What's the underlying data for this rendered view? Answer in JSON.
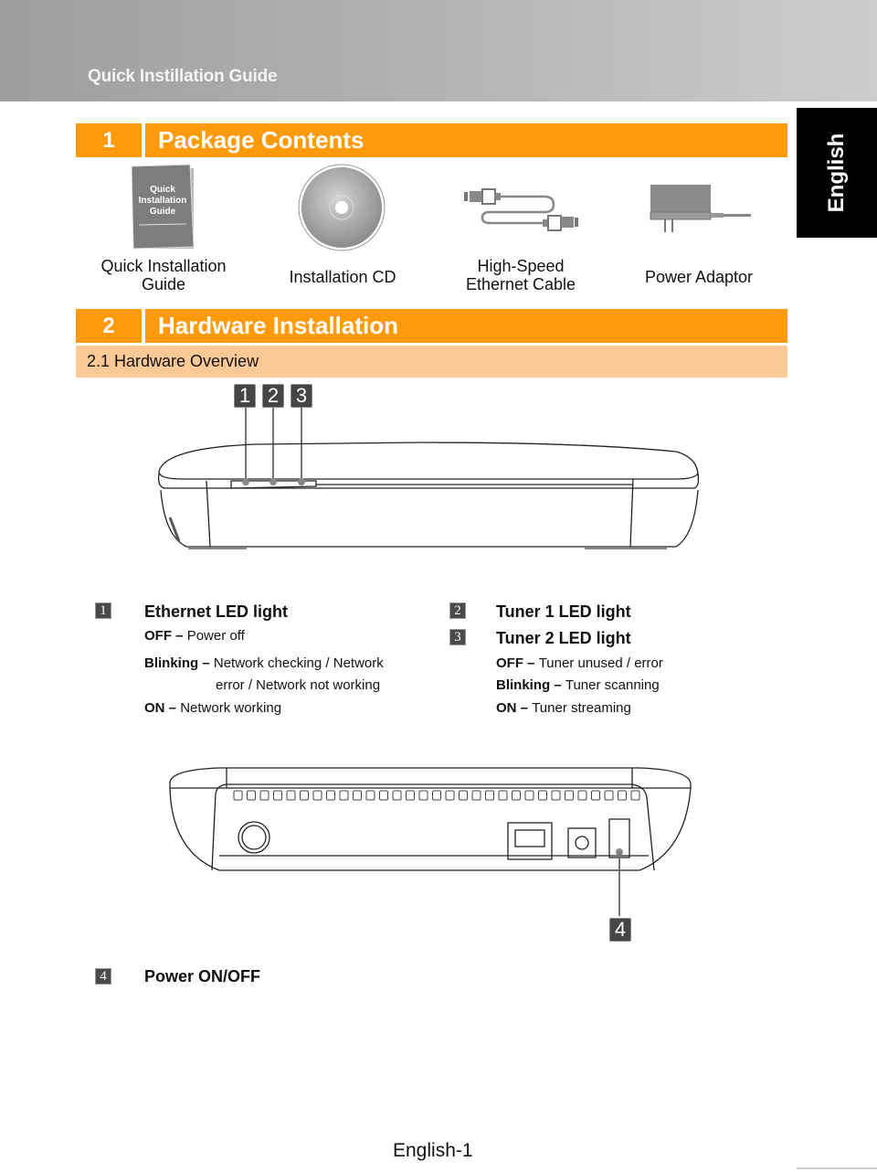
{
  "header": {
    "title": "Quick Instillation Guide"
  },
  "language_tab": "English",
  "sections": [
    {
      "number": "1",
      "title": "Package Contents",
      "items": [
        {
          "label_line1": "Quick Installation",
          "label_line2": "Guide",
          "icon": "booklet-icon",
          "booklet_text": [
            "Quick",
            "Installation",
            "Guide"
          ]
        },
        {
          "label_line1": "Installation CD",
          "label_line2": "",
          "icon": "cd-icon"
        },
        {
          "label_line1": "High-Speed",
          "label_line2": "Ethernet Cable",
          "icon": "ethernet-cable-icon"
        },
        {
          "label_line1": "Power Adaptor",
          "label_line2": "",
          "icon": "power-adaptor-icon"
        }
      ]
    },
    {
      "number": "2",
      "title": "Hardware Installation",
      "subsection": "2.1 Hardware Overview"
    }
  ],
  "diagram": {
    "front_callouts": [
      "1",
      "2",
      "3"
    ],
    "rear_callout": "4"
  },
  "legend": {
    "ethernet": {
      "badge": "1",
      "title": "Ethernet LED light",
      "states": [
        {
          "state": "OFF",
          "sep": " – ",
          "desc": "Power off"
        },
        {
          "state": "Blinking",
          "sep": " – ",
          "desc": "Network checking / Network"
        },
        {
          "state": "",
          "sep": "",
          "desc": "error / Network not working"
        },
        {
          "state": "ON",
          "sep": " – ",
          "desc": "Network working"
        }
      ]
    },
    "tuner1": {
      "badge": "2",
      "title": "Tuner 1 LED light"
    },
    "tuner2": {
      "badge": "3",
      "title": "Tuner 2 LED light",
      "states": [
        {
          "state": "OFF",
          "sep": " – ",
          "desc": "Tuner unused / error"
        },
        {
          "state": "Blinking",
          "sep": " – ",
          "desc": "Tuner scanning"
        },
        {
          "state": "ON",
          "sep": " – ",
          "desc": "Tuner streaming"
        }
      ]
    },
    "power": {
      "badge": "4",
      "title": "Power ON/OFF"
    }
  },
  "footer": {
    "page_number": "English-1"
  }
}
